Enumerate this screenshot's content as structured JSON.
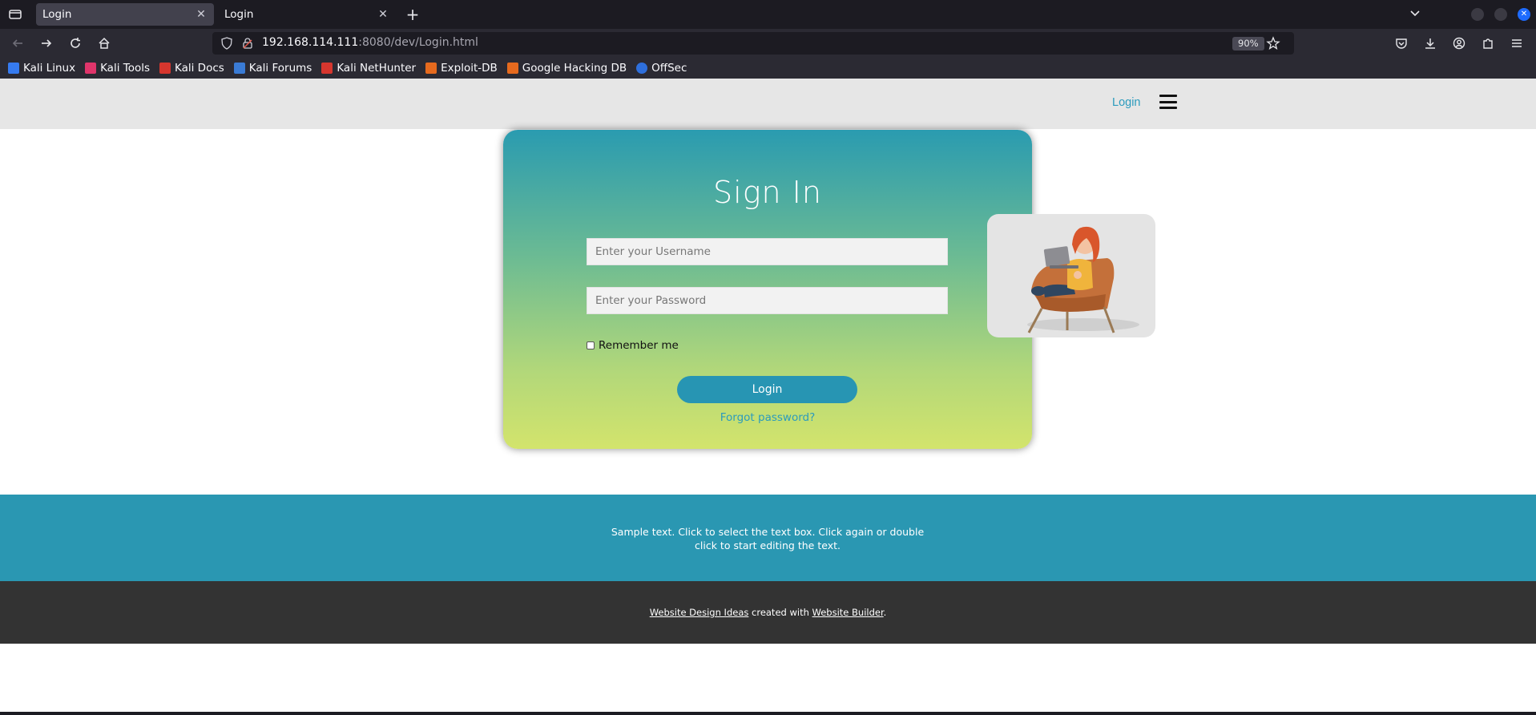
{
  "browser": {
    "tabs": [
      {
        "title": "Login",
        "active": true
      },
      {
        "title": "Login",
        "active": false
      }
    ],
    "url": {
      "host": "192.168.114.111",
      "rest": ":8080/dev/Login.html"
    },
    "zoom": "90%",
    "bookmarks": [
      {
        "label": "Kali Linux",
        "color": "#367bf0"
      },
      {
        "label": "Kali Tools",
        "color": "#e0356b"
      },
      {
        "label": "Kali Docs",
        "color": "#d6362e"
      },
      {
        "label": "Kali Forums",
        "color": "#3a7bd5"
      },
      {
        "label": "Kali NetHunter",
        "color": "#d6362e"
      },
      {
        "label": "Exploit-DB",
        "color": "#e66a1e"
      },
      {
        "label": "Google Hacking DB",
        "color": "#e66a1e"
      },
      {
        "label": "OffSec",
        "color": "#2e6fdc"
      }
    ]
  },
  "site": {
    "header": {
      "login_link": "Login"
    },
    "card": {
      "title": "Sign In",
      "username_placeholder": "Enter your Username",
      "password_placeholder": "Enter your Password",
      "remember_label": "Remember me",
      "login_button": "Login",
      "forgot_link": "Forgot password?"
    },
    "footer": {
      "sample_text": "Sample text. Click to select the text box. Click again or double click to start editing the text.",
      "link1": "Website Design Ideas",
      "middle": " created with ",
      "link2": "Website Builder",
      "end": "."
    }
  },
  "colors": {
    "accent": "#2a97b2",
    "link": "#2b9bbd"
  }
}
